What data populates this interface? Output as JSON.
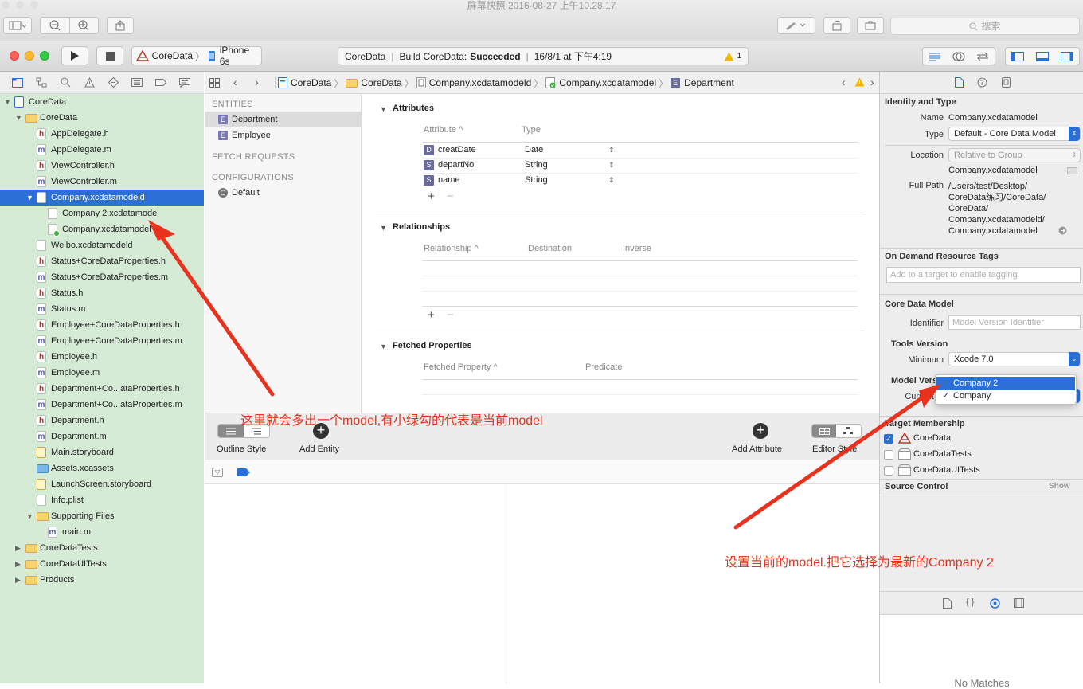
{
  "window": {
    "title": "屏幕快照 2016-08-27 上午10.28.17"
  },
  "titlebar": {
    "search_placeholder": "搜索"
  },
  "toolbar": {
    "scheme": "CoreData",
    "device": "iPhone 6s",
    "activity": {
      "project": "CoreData",
      "build_label": "Build CoreData:",
      "build_status": "Succeeded",
      "timestamp": "16/8/1 at 下午4:19",
      "warning_count": "1"
    }
  },
  "navigator": {
    "items": [
      {
        "label": "CoreData",
        "kind": "project",
        "indent": 0,
        "disclosure": "open"
      },
      {
        "label": "CoreData",
        "kind": "folder",
        "indent": 1,
        "disclosure": "open"
      },
      {
        "label": "AppDelegate.h",
        "kind": "h",
        "indent": 2
      },
      {
        "label": "AppDelegate.m",
        "kind": "m",
        "indent": 2
      },
      {
        "label": "ViewController.h",
        "kind": "h",
        "indent": 2
      },
      {
        "label": "ViewController.m",
        "kind": "m",
        "indent": 2
      },
      {
        "label": "Company.xcdatamodeld",
        "kind": "model",
        "indent": 2,
        "disclosure": "open",
        "selected": true
      },
      {
        "label": "Company 2.xcdatamodel",
        "kind": "model",
        "indent": 3
      },
      {
        "label": "Company.xcdatamodel",
        "kind": "model-current",
        "indent": 3
      },
      {
        "label": "Weibo.xcdatamodeld",
        "kind": "model",
        "indent": 2
      },
      {
        "label": "Status+CoreDataProperties.h",
        "kind": "h",
        "indent": 2
      },
      {
        "label": "Status+CoreDataProperties.m",
        "kind": "m",
        "indent": 2
      },
      {
        "label": "Status.h",
        "kind": "h",
        "indent": 2
      },
      {
        "label": "Status.m",
        "kind": "m",
        "indent": 2
      },
      {
        "label": "Employee+CoreDataProperties.h",
        "kind": "h",
        "indent": 2
      },
      {
        "label": "Employee+CoreDataProperties.m",
        "kind": "m",
        "indent": 2
      },
      {
        "label": "Employee.h",
        "kind": "h",
        "indent": 2
      },
      {
        "label": "Employee.m",
        "kind": "m",
        "indent": 2
      },
      {
        "label": "Department+Co...ataProperties.h",
        "kind": "h",
        "indent": 2
      },
      {
        "label": "Department+Co...ataProperties.m",
        "kind": "m",
        "indent": 2
      },
      {
        "label": "Department.h",
        "kind": "h",
        "indent": 2
      },
      {
        "label": "Department.m",
        "kind": "m",
        "indent": 2
      },
      {
        "label": "Main.storyboard",
        "kind": "storyboard",
        "indent": 2
      },
      {
        "label": "Assets.xcassets",
        "kind": "assets",
        "indent": 2
      },
      {
        "label": "LaunchScreen.storyboard",
        "kind": "storyboard",
        "indent": 2
      },
      {
        "label": "Info.plist",
        "kind": "plist",
        "indent": 2
      },
      {
        "label": "Supporting Files",
        "kind": "folder",
        "indent": 2,
        "disclosure": "open"
      },
      {
        "label": "main.m",
        "kind": "m",
        "indent": 3
      },
      {
        "label": "CoreDataTests",
        "kind": "folder",
        "indent": 1,
        "disclosure": "closed"
      },
      {
        "label": "CoreDataUITests",
        "kind": "folder",
        "indent": 1,
        "disclosure": "closed"
      },
      {
        "label": "Products",
        "kind": "folder",
        "indent": 1,
        "disclosure": "closed"
      }
    ]
  },
  "jumpbar": {
    "crumbs": [
      "CoreData",
      "CoreData",
      "Company.xcdatamodeld",
      "Company.xcdatamodel",
      "Department"
    ]
  },
  "entities": {
    "entities_header": "ENTITIES",
    "list": [
      "Department",
      "Employee"
    ],
    "fetch_header": "FETCH REQUESTS",
    "config_header": "CONFIGURATIONS",
    "configs": [
      "Default"
    ]
  },
  "detail": {
    "attributes": {
      "title": "Attributes",
      "col_attr": "Attribute",
      "col_type": "Type",
      "rows": [
        {
          "icon": "D",
          "name": "creatDate",
          "type": "Date"
        },
        {
          "icon": "S",
          "name": "departNo",
          "type": "String"
        },
        {
          "icon": "S",
          "name": "name",
          "type": "String"
        }
      ]
    },
    "relationships": {
      "title": "Relationships",
      "col1": "Relationship",
      "col2": "Destination",
      "col3": "Inverse"
    },
    "fetched": {
      "title": "Fetched Properties",
      "col1": "Fetched Property",
      "col2": "Predicate"
    },
    "plus": "+",
    "minus": "−"
  },
  "editor_bar": {
    "outline_style": "Outline Style",
    "add_entity": "Add Entity",
    "add_attribute": "Add Attribute",
    "editor_style": "Editor Style"
  },
  "inspector": {
    "identity_header": "Identity and Type",
    "name_label": "Name",
    "name_value": "Company.xcdatamodel",
    "type_label": "Type",
    "type_value": "Default - Core Data Model",
    "location_label": "Location",
    "location_value": "Relative to Group",
    "location_file": "Company.xcdatamodel",
    "fullpath_label": "Full Path",
    "fullpath_lines": [
      "/Users/test/Desktop/",
      "CoreData练习/CoreData/",
      "CoreData/",
      "Company.xcdatamodeld/",
      "Company.xcdatamodel"
    ],
    "ondemand_header": "On Demand Resource Tags",
    "ondemand_placeholder": "Add to a target to enable tagging",
    "cdm_header": "Core Data Model",
    "identifier_label": "Identifier",
    "identifier_placeholder": "Model Version Identifier",
    "tools_header": "Tools Version",
    "minimum_label": "Minimum",
    "minimum_value": "Xcode 7.0",
    "model_version_header": "Model Version",
    "current_label": "Current",
    "target_header": "Target Membership",
    "targets": [
      {
        "label": "CoreData",
        "checked": true
      },
      {
        "label": "CoreDataTests",
        "checked": false
      },
      {
        "label": "CoreDataUITests",
        "checked": false
      }
    ],
    "source_control_header": "Source Control",
    "show_label": "Show",
    "no_matches": "No Matches"
  },
  "version_menu": {
    "items": [
      {
        "label": "Company 2",
        "highlighted": true,
        "checked": false
      },
      {
        "label": "Company",
        "highlighted": false,
        "checked": true
      }
    ]
  },
  "annotations": {
    "left_note": "这里就会多出一个model,有小绿勾的代表是当前model",
    "right_note": "设置当前的model.把它选择为最新的Company 2"
  },
  "colors": {
    "selection": "#2b6fd7",
    "navigator_bg": "#d6ebd6",
    "annotation": "#e8321e",
    "success_check": "#3cb043"
  }
}
